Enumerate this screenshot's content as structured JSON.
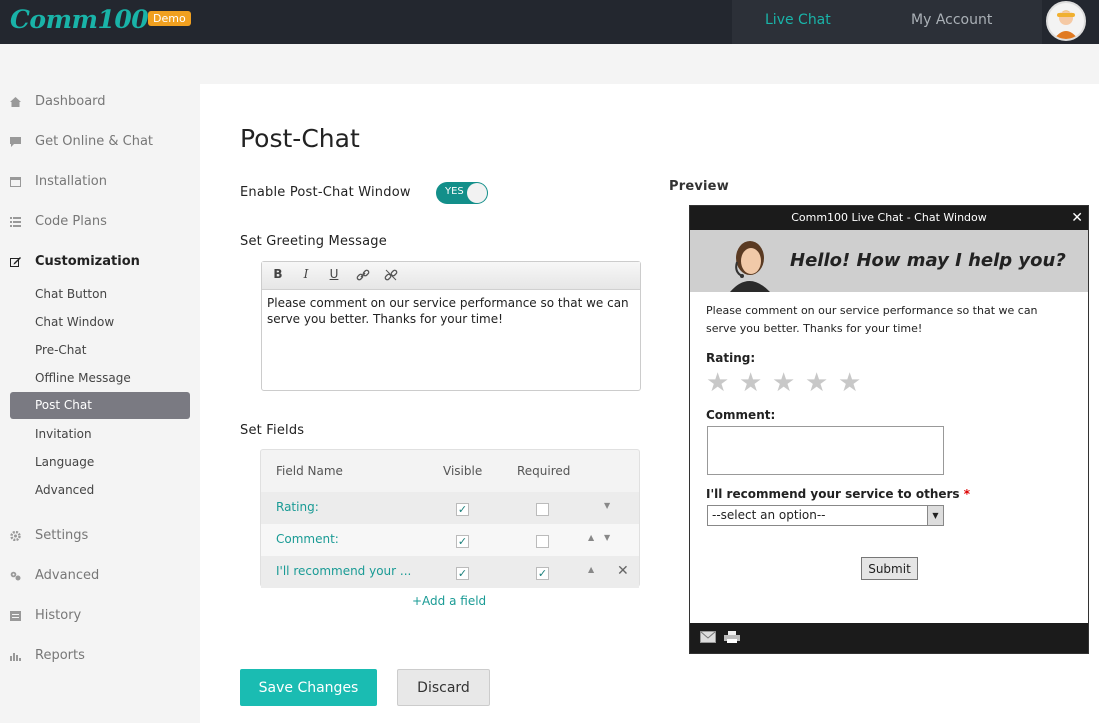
{
  "app": {
    "logo": "Comm100",
    "badge": "Demo",
    "nav": {
      "live_chat": "Live Chat",
      "my_account": "My Account"
    }
  },
  "sidebar": {
    "items": [
      {
        "label": "Dashboard",
        "icon": "home-icon"
      },
      {
        "label": "Get Online & Chat",
        "icon": "chat-icon"
      },
      {
        "label": "Installation",
        "icon": "window-icon"
      },
      {
        "label": "Code Plans",
        "icon": "list-icon"
      },
      {
        "label": "Customization",
        "icon": "edit-icon"
      },
      {
        "label": "Settings",
        "icon": "gear-icon"
      },
      {
        "label": "Advanced",
        "icon": "gears-icon"
      },
      {
        "label": "History",
        "icon": "history-icon"
      },
      {
        "label": "Reports",
        "icon": "bar-chart-icon"
      }
    ],
    "sub_items": [
      "Chat Button",
      "Chat Window",
      "Pre-Chat",
      "Offline Message",
      "Post Chat",
      "Invitation",
      "Language",
      "Advanced"
    ],
    "active_sub": "Post Chat"
  },
  "main": {
    "title": "Post-Chat",
    "enable_label": "Enable Post-Chat Window",
    "toggle_text": "YES",
    "greeting_label": "Set Greeting Message",
    "greeting_text": "Please comment on our service performance so that we can serve you better. Thanks for your time!",
    "fields_label": "Set Fields",
    "fields_headers": {
      "name": "Field Name",
      "visible": "Visible",
      "required": "Required"
    },
    "fields": [
      {
        "name": "Rating:",
        "visible": true,
        "required": false
      },
      {
        "name": "Comment:",
        "visible": true,
        "required": false
      },
      {
        "name": "I'll recommend your ...",
        "visible": true,
        "required": true
      }
    ],
    "add_field": "+Add a field",
    "save": "Save Changes",
    "discard": "Discard"
  },
  "preview": {
    "label": "Preview",
    "window_title": "Comm100 Live Chat - Chat Window",
    "close": "✕",
    "hello": "Hello! How may I help you?",
    "body": "Please comment on our service performance so that we can serve you better. Thanks for your time!",
    "rating_label": "Rating:",
    "comment_label": "Comment:",
    "recommend_label": "I'll recommend your service to others",
    "required_mark": "*",
    "select_value": "--select an option--",
    "submit": "Submit"
  },
  "colors": {
    "accent": "#1abcb2",
    "topbar": "#23272f",
    "active_sub": "#7a7a82"
  }
}
